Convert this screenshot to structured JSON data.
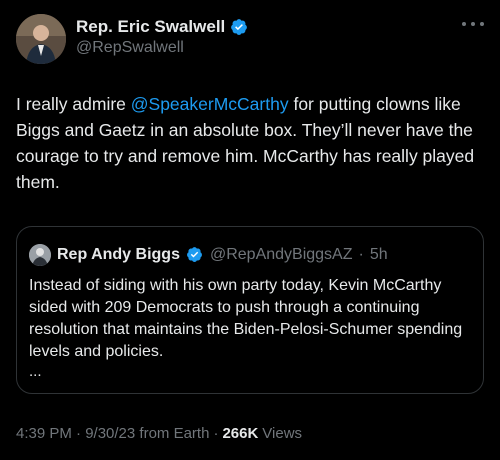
{
  "author": {
    "name": "Rep. Eric Swalwell",
    "handle": "@RepSwalwell",
    "verified_icon": "verified-badge-icon",
    "verified_color": "#1d9bf0"
  },
  "more_icon": "more-options-icon",
  "tweet": {
    "text_before": "I really admire ",
    "mention": "@SpeakerMcCarthy",
    "text_after": " for putting clowns like Biggs and Gaetz in an absolute box. They’ll never have the courage to try and remove him. McCarthy has really played them."
  },
  "quoted": {
    "name": "Rep Andy Biggs",
    "handle": "@RepAndyBiggsAZ",
    "separator": "·",
    "time": "5h",
    "text": "Instead of siding with his own party today, Kevin McCarthy sided with 209 Democrats to push through a continuing resolution that maintains the Biden-Pelosi-Schumer spending levels and policies.",
    "ellipsis": "..."
  },
  "meta": {
    "timestamp": "4:39 PM · 9/30/23 from Earth",
    "separator": "·",
    "views_count": "266K",
    "views_label": "Views"
  },
  "colors": {
    "background": "#000000",
    "text": "#e7e9ea",
    "muted": "#71767b",
    "link": "#1d9bf0",
    "border": "#2f3336"
  }
}
